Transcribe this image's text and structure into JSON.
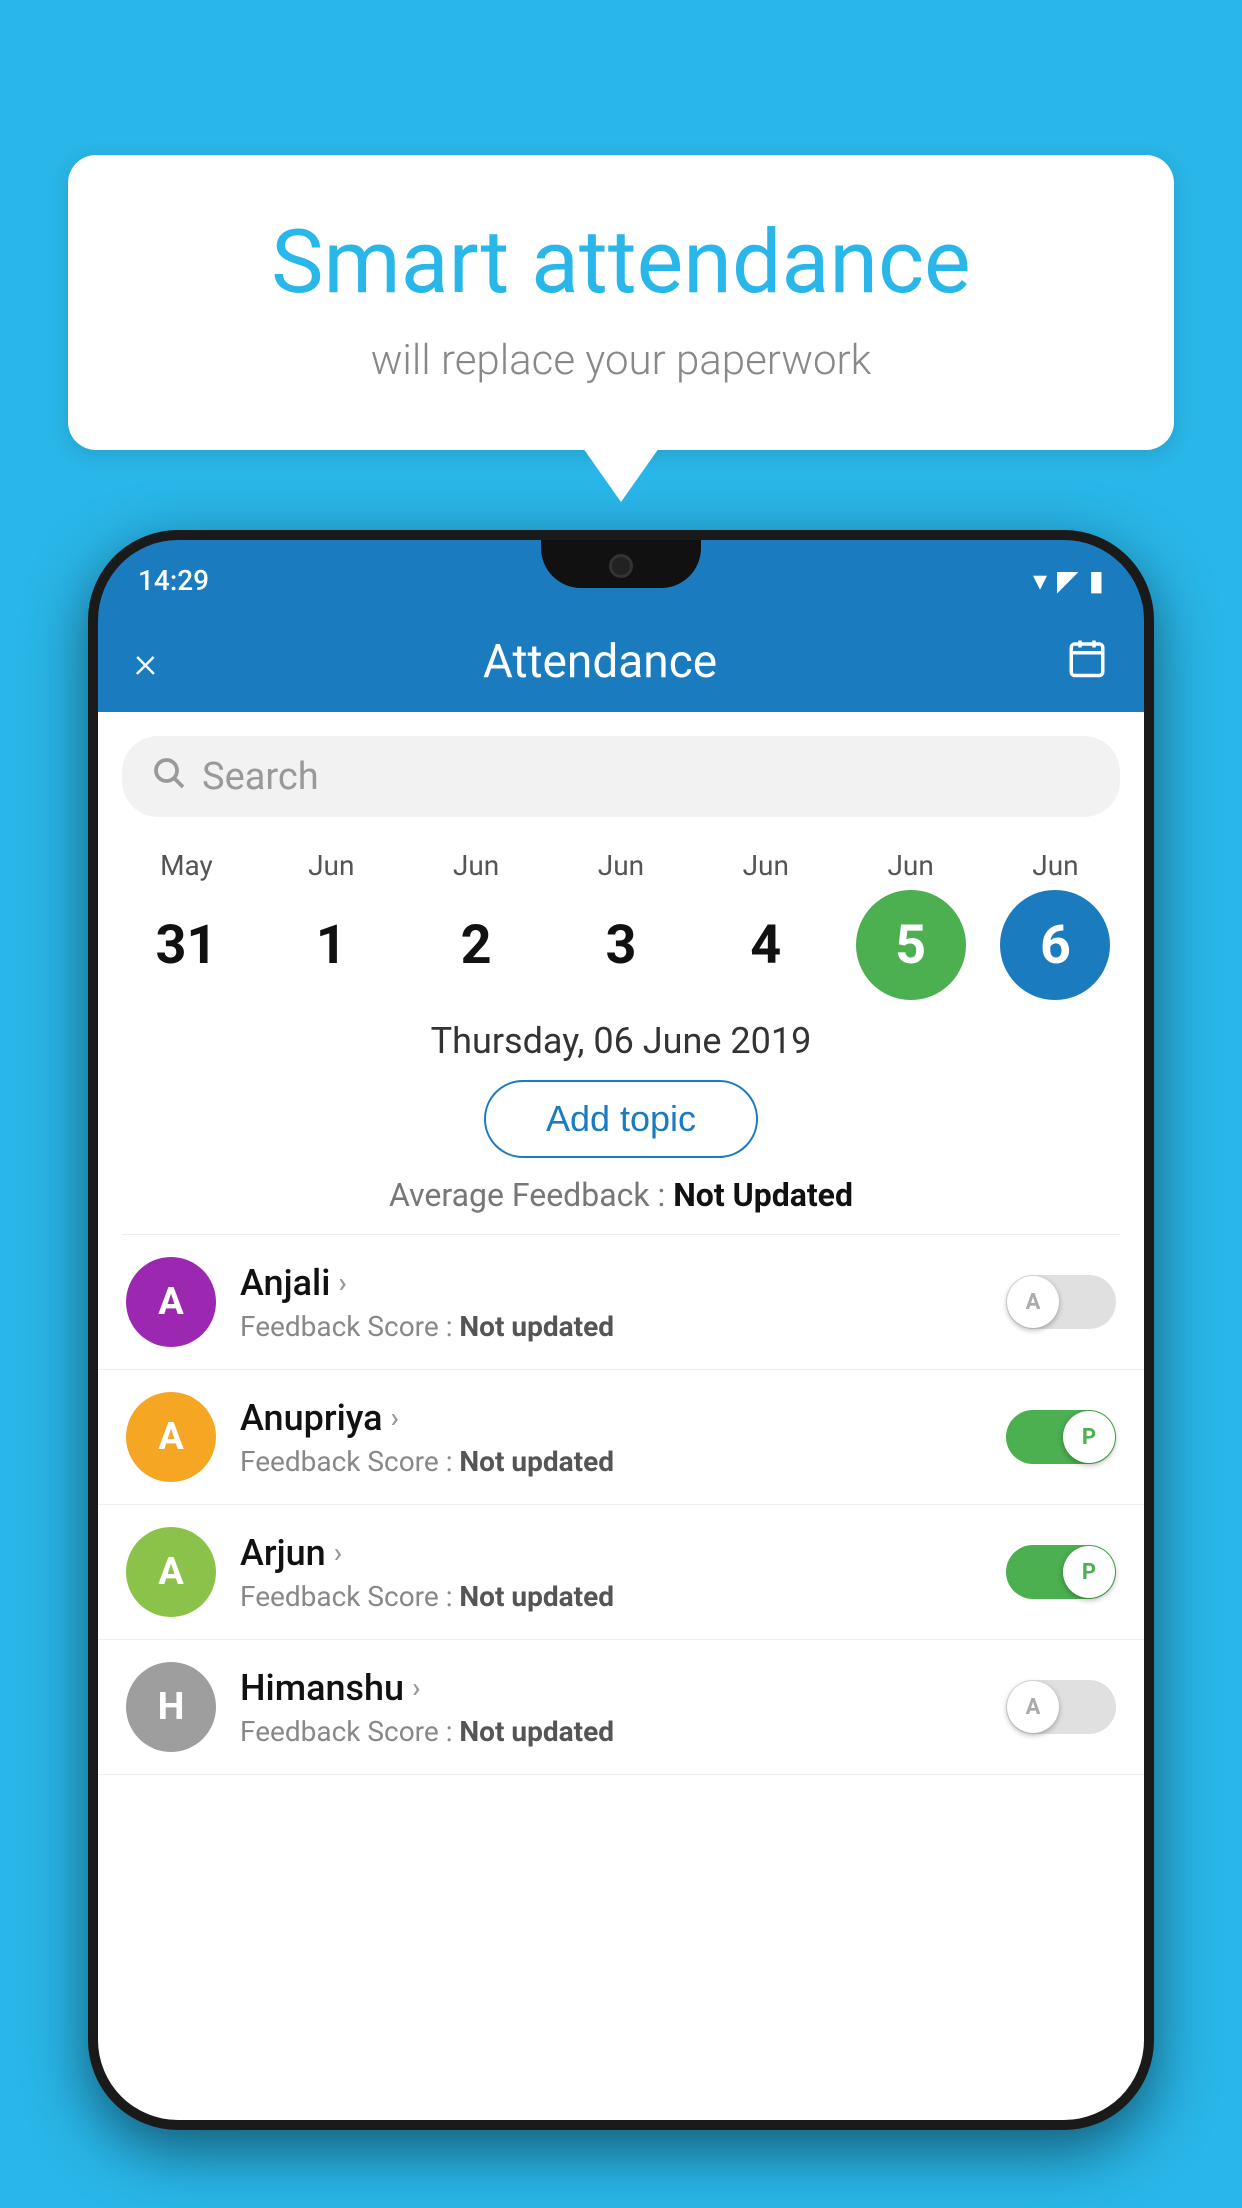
{
  "background_color": "#29b6e8",
  "bubble": {
    "title": "Smart attendance",
    "subtitle": "will replace your paperwork"
  },
  "header": {
    "time": "14:29",
    "title": "Attendance",
    "close_label": "×",
    "calendar_icon": "calendar-icon"
  },
  "search": {
    "placeholder": "Search"
  },
  "calendar": {
    "days": [
      {
        "month": "May",
        "date": "31",
        "state": "normal"
      },
      {
        "month": "Jun",
        "date": "1",
        "state": "normal"
      },
      {
        "month": "Jun",
        "date": "2",
        "state": "normal"
      },
      {
        "month": "Jun",
        "date": "3",
        "state": "normal"
      },
      {
        "month": "Jun",
        "date": "4",
        "state": "normal"
      },
      {
        "month": "Jun",
        "date": "5",
        "state": "today"
      },
      {
        "month": "Jun",
        "date": "6",
        "state": "selected"
      }
    ]
  },
  "selected_date_label": "Thursday, 06 June 2019",
  "add_topic_label": "Add topic",
  "avg_feedback": {
    "label": "Average Feedback : ",
    "value": "Not Updated"
  },
  "students": [
    {
      "name": "Anjali",
      "avatar_letter": "A",
      "avatar_color": "#9c27b0",
      "feedback": "Feedback Score : ",
      "feedback_value": "Not updated",
      "toggle_state": "off",
      "toggle_label": "A"
    },
    {
      "name": "Anupriya",
      "avatar_letter": "A",
      "avatar_color": "#f5a623",
      "feedback": "Feedback Score : ",
      "feedback_value": "Not updated",
      "toggle_state": "on",
      "toggle_label": "P"
    },
    {
      "name": "Arjun",
      "avatar_letter": "A",
      "avatar_color": "#8bc34a",
      "feedback": "Feedback Score : ",
      "feedback_value": "Not updated",
      "toggle_state": "on",
      "toggle_label": "P"
    },
    {
      "name": "Himanshu",
      "avatar_letter": "H",
      "avatar_color": "#9e9e9e",
      "feedback": "Feedback Score : ",
      "feedback_value": "Not updated",
      "toggle_state": "off",
      "toggle_label": "A"
    }
  ]
}
